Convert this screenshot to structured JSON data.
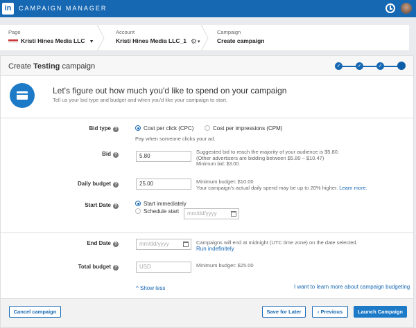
{
  "topbar": {
    "app_name": "CAMPAIGN MANAGER",
    "logo_text": "in"
  },
  "breadcrumb": {
    "page": {
      "label": "Page",
      "value": "Kristi Hines Media LLC"
    },
    "account": {
      "label": "Account",
      "value": "Kristi Hines Media LLC_1"
    },
    "campaign": {
      "label": "Campaign",
      "value": "Create campaign"
    }
  },
  "card": {
    "title_prefix": "Create",
    "title_bold": "Testing",
    "title_suffix": "campaign",
    "progress_current_step": 4,
    "progress_total_steps": 4
  },
  "intro": {
    "heading": "Let's figure out how much you'd like to spend on your campaign",
    "sub": "Tell us your bid type and budget and when you'd like your campaign to start."
  },
  "form": {
    "bid_type": {
      "label": "Bid type",
      "option_cpc": "Cost per click (CPC)",
      "option_cpm": "Cost per impressions (CPM)",
      "hint": "Pay when someone clicks your ad."
    },
    "bid": {
      "label": "Bid",
      "value": "5.80",
      "note1": "Suggested bid to reach the majority of your audience is $5.80.",
      "note2": "(Other advertisers are bidding between $5.80 – $10.47)",
      "note3": "Minimum bid: $3.00."
    },
    "daily_budget": {
      "label": "Daily budget",
      "value": "25.00",
      "note1": "Minimum budget: $10.00",
      "note2": "Your campaign's actual daily spend may be up to 20% higher.",
      "link": "Learn more."
    },
    "start_date": {
      "label": "Start Date",
      "option_immediate": "Start immediately",
      "option_schedule": "Schedule start",
      "placeholder": "mm/dd/yyyy"
    },
    "end_date": {
      "label": "End Date",
      "placeholder": "mm/dd/yyyy",
      "note": "Campaigns will end at midnight (UTC time zone) on the date selected.",
      "link": "Run indefinitely"
    },
    "total_budget": {
      "label": "Total budget",
      "placeholder": "USD",
      "note": "Minimum budget: $25.00"
    },
    "show_less": "^ Show less",
    "learn_more": "I want to learn more about campaign budgeting"
  },
  "footer": {
    "cancel": "Cancel campaign",
    "save": "Save for Later",
    "previous": "‹ Previous",
    "launch": "Launch Campaign"
  }
}
